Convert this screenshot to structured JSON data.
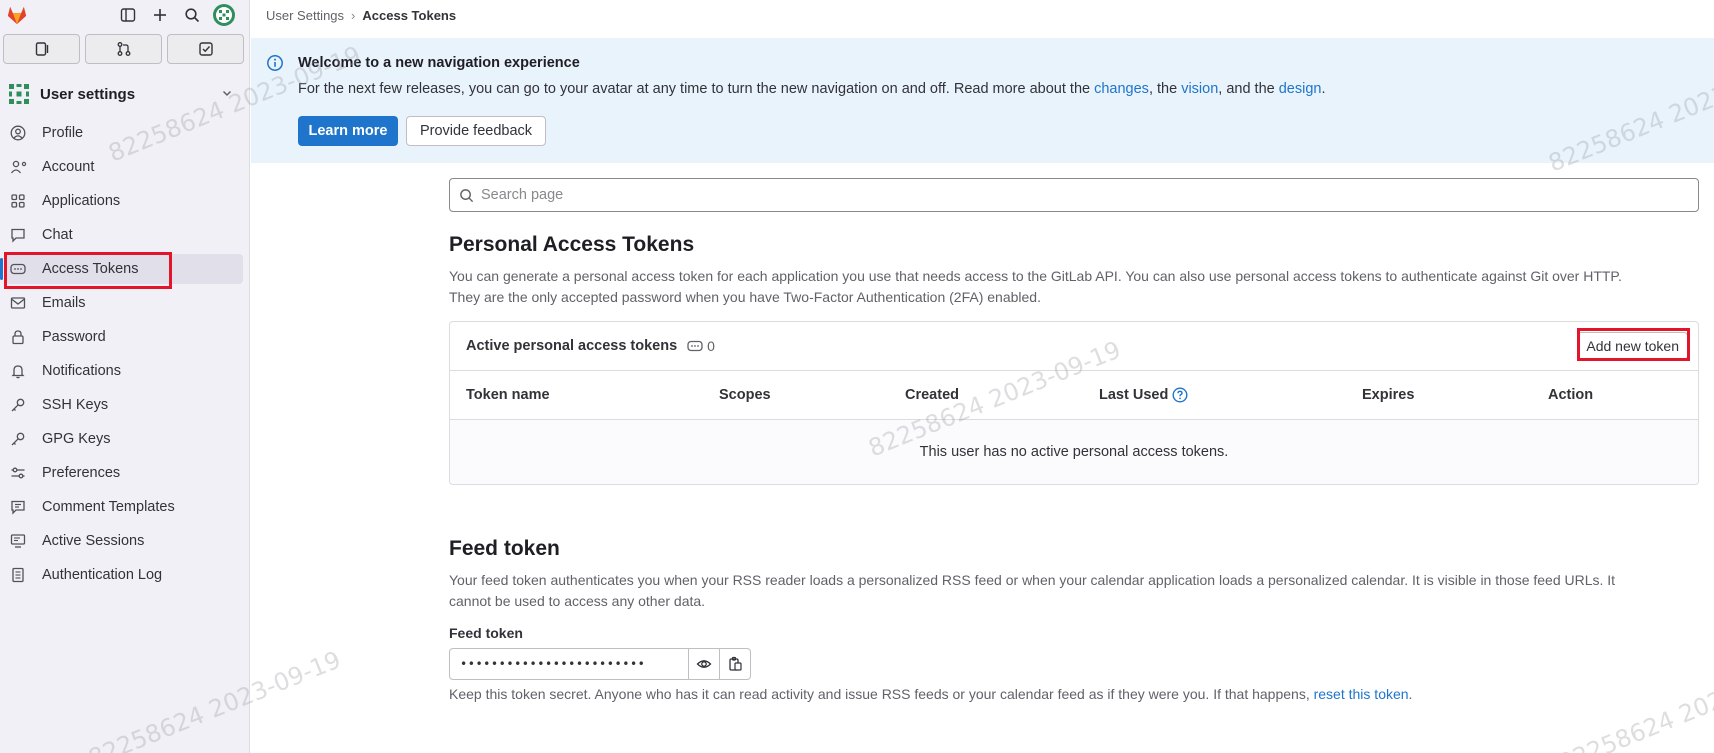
{
  "sidebar": {
    "context_label": "User settings",
    "items": [
      {
        "label": "Profile",
        "icon": "profile-icon"
      },
      {
        "label": "Account",
        "icon": "account-icon"
      },
      {
        "label": "Applications",
        "icon": "applications-icon"
      },
      {
        "label": "Chat",
        "icon": "chat-icon"
      },
      {
        "label": "Access Tokens",
        "icon": "token-icon",
        "active": true
      },
      {
        "label": "Emails",
        "icon": "mail-icon"
      },
      {
        "label": "Password",
        "icon": "lock-icon"
      },
      {
        "label": "Notifications",
        "icon": "bell-icon"
      },
      {
        "label": "SSH Keys",
        "icon": "key-icon"
      },
      {
        "label": "GPG Keys",
        "icon": "key-icon"
      },
      {
        "label": "Preferences",
        "icon": "preferences-icon"
      },
      {
        "label": "Comment Templates",
        "icon": "comment-icon"
      },
      {
        "label": "Active Sessions",
        "icon": "monitor-icon"
      },
      {
        "label": "Authentication Log",
        "icon": "log-icon"
      }
    ]
  },
  "breadcrumb": {
    "parent": "User Settings",
    "separator": "›",
    "current": "Access Tokens"
  },
  "banner": {
    "title": "Welcome to a new navigation experience",
    "text_prefix": "For the next few releases, you can go to your avatar at any time to turn the new navigation on and off. Read more about the ",
    "link_changes": "changes",
    "text_mid1": ", the ",
    "link_vision": "vision",
    "text_mid2": ", and the ",
    "link_design": "design",
    "text_end": ".",
    "learn_more": "Learn more",
    "feedback": "Provide feedback"
  },
  "search": {
    "placeholder": "Search page"
  },
  "pat": {
    "title": "Personal Access Tokens",
    "description_line1": "You can generate a personal access token for each application you use that needs access to the GitLab API. You can also use personal access tokens to authenticate against Git over HTTP.",
    "description_line2": "They are the only accepted password when you have Two-Factor Authentication (2FA) enabled.",
    "card_title": "Active personal access tokens",
    "count": "0",
    "add_button": "Add new token",
    "columns": [
      "Token name",
      "Scopes",
      "Created",
      "Last Used",
      "Expires",
      "Action"
    ],
    "empty_message": "This user has no active personal access tokens."
  },
  "feed": {
    "title": "Feed token",
    "description_line1": "Your feed token authenticates you when your RSS reader loads a personalized RSS feed or when your calendar application loads a personalized calendar. It is visible in those feed URLs. It",
    "description_line2": "cannot be used to access any other data.",
    "label": "Feed token",
    "masked_value": "••••••••••••••••••••••••",
    "help_prefix": "Keep this token secret. Anyone who has it can read activity and issue RSS feeds or your calendar feed as if they were you. If that happens, ",
    "help_link": "reset this token",
    "help_end": "."
  },
  "watermark": {
    "text": "82258624  2023-09-19"
  },
  "colors": {
    "accent": "#1f75cb",
    "highlight": "#e3152b",
    "banner_bg": "#e9f3fc",
    "sidebar_bg": "#f1f0f7"
  }
}
